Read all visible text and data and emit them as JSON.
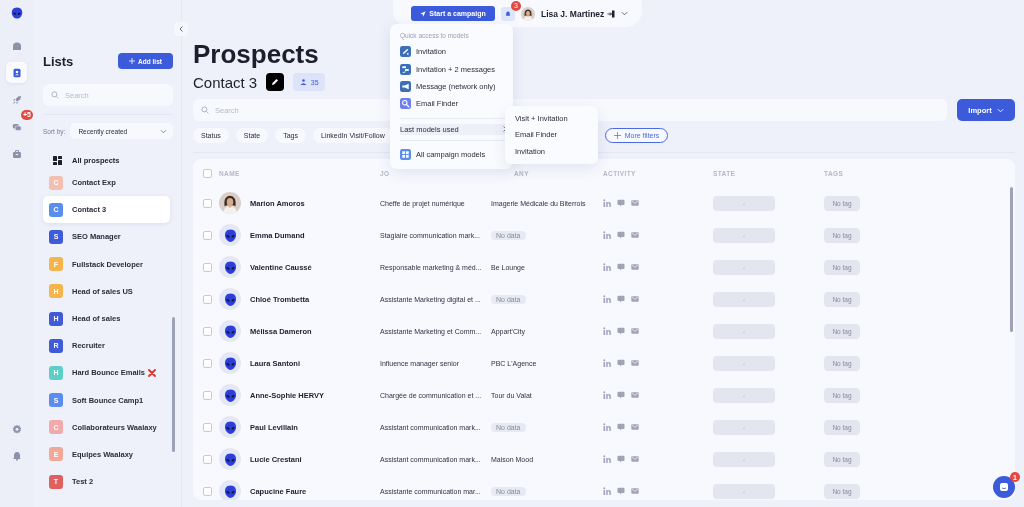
{
  "rail": {
    "items": [
      {
        "kind": "home",
        "selected": false
      },
      {
        "kind": "contacts",
        "selected": true
      },
      {
        "kind": "rocket",
        "selected": false
      },
      {
        "kind": "chat",
        "selected": false,
        "badge": "+5"
      },
      {
        "kind": "box",
        "selected": false
      }
    ],
    "bottom_items": [
      {
        "kind": "settings"
      },
      {
        "kind": "bell"
      }
    ]
  },
  "lists_panel": {
    "title": "Lists",
    "add_button": "Add list",
    "search": {
      "placeholder": "Search"
    },
    "sort_label": "Sort by:",
    "sort_value": "Recently created",
    "all_prospects": "All prospects",
    "items": [
      {
        "letter": "C",
        "name": "Contact Exp",
        "color": "#f4bfb0",
        "selected": false,
        "warning": false
      },
      {
        "letter": "C",
        "name": "Contact 3",
        "color": "#5b8def",
        "selected": true,
        "warning": false
      },
      {
        "letter": "S",
        "name": "SEO Manager",
        "color": "#3f5bd8",
        "selected": false,
        "warning": false
      },
      {
        "letter": "F",
        "name": "Fullstack Developer",
        "color": "#f5b54a",
        "selected": false,
        "warning": false
      },
      {
        "letter": "H",
        "name": "Head of sales US",
        "color": "#f5b54a",
        "selected": false,
        "warning": false
      },
      {
        "letter": "H",
        "name": "Head of sales",
        "color": "#3f5bd8",
        "selected": false,
        "warning": false
      },
      {
        "letter": "R",
        "name": "Recruiter",
        "color": "#3f5bd8",
        "selected": false,
        "warning": false
      },
      {
        "letter": "H",
        "name": "Hard Bounce Emails",
        "color": "#5ccfc9",
        "selected": false,
        "warning": true
      },
      {
        "letter": "S",
        "name": "Soft Bounce Camp1",
        "color": "#5b8def",
        "selected": false,
        "warning": false
      },
      {
        "letter": "C",
        "name": "Collaborateurs Waalaxy",
        "color": "#f2a9a9",
        "selected": false,
        "warning": false
      },
      {
        "letter": "E",
        "name": "Equipes Waalaxy",
        "color": "#f2a898",
        "selected": false,
        "warning": false
      },
      {
        "letter": "T",
        "name": "Test 2",
        "color": "#e06060",
        "selected": false,
        "warning": false
      }
    ]
  },
  "header": {
    "campaign_button": "Start a campaign",
    "notification_count": "3",
    "user_name": "Lisa J. Martinez"
  },
  "title": "Prospects",
  "list_name": "Contact 3",
  "member_count": "35",
  "search": {
    "placeholder": "Search"
  },
  "import_button": "Import",
  "filters": [
    "Status",
    "State",
    "Tags",
    "LinkedIn Visit/Follow"
  ],
  "more_filters": "More filters",
  "table": {
    "all_checked": false,
    "columns": [
      "NAME",
      "JO",
      "ANY",
      "ACTIVITY",
      "STATE",
      "TAGS"
    ],
    "rows": [
      {
        "checked": false,
        "name": "Marion Amoros",
        "job": "Cheffe de projet numérique",
        "company": {
          "kind": "text",
          "text": "Imagerie Médicale du Biterrois"
        },
        "state": "-",
        "tags": "No tag"
      },
      {
        "checked": false,
        "avatar": {
          "kind": "alien"
        },
        "name": "Emma Dumand",
        "job": "Stagiaire communication mark...",
        "company": {
          "kind": "empty",
          "text": "No data"
        },
        "state": "-",
        "tags": "No tag"
      },
      {
        "checked": false,
        "avatar": {
          "kind": "alien"
        },
        "name": "Valentine Caussé",
        "job": "Responsable marketing & méd...",
        "company": {
          "kind": "text",
          "text": "Be Lounge"
        },
        "state": "-",
        "tags": "No tag"
      },
      {
        "checked": false,
        "avatar": {
          "kind": "alien"
        },
        "name": "Chloé Trombetta",
        "job": "Assistante Marketing digital et ...",
        "company": {
          "kind": "empty",
          "text": "No data"
        },
        "state": "-",
        "tags": "No tag"
      },
      {
        "checked": false,
        "avatar": {
          "kind": "alien"
        },
        "name": "Mélissa Dameron",
        "job": "Assistante Marketing et Comm...",
        "company": {
          "kind": "text",
          "text": "Appart'City"
        },
        "state": "-",
        "tags": "No tag"
      },
      {
        "checked": false,
        "avatar": {
          "kind": "alien"
        },
        "name": "Laura Santoni",
        "job": "Influence manager senior",
        "company": {
          "kind": "text",
          "text": "PBC L'Agence"
        },
        "state": "-",
        "tags": "No tag"
      },
      {
        "checked": false,
        "avatar": {
          "kind": "alien"
        },
        "name": "Anne-Sophie HERVY",
        "job": "Chargée de communication et ...",
        "company": {
          "kind": "text",
          "text": "Tour du Valat"
        },
        "state": "-",
        "tags": "No tag"
      },
      {
        "checked": false,
        "avatar": {
          "kind": "alien"
        },
        "name": "Paul Levillain",
        "job": "Assistant communication mark...",
        "company": {
          "kind": "empty",
          "text": "No data"
        },
        "state": "-",
        "tags": "No tag"
      },
      {
        "checked": false,
        "avatar": {
          "kind": "alien"
        },
        "name": "Lucie Crestani",
        "job": "Assistant communication mark...",
        "company": {
          "kind": "text",
          "text": "Maison Mood"
        },
        "state": "-",
        "tags": "No tag"
      },
      {
        "checked": false,
        "avatar": {
          "kind": "alien"
        },
        "name": "Capucine Faure",
        "job": "Assistante communication mar...",
        "company": {
          "kind": "empty",
          "text": "No data"
        },
        "state": "-",
        "tags": "No tag"
      }
    ]
  },
  "campaign_menu": {
    "heading": "Quick access to models",
    "items": [
      {
        "kind": "link",
        "label": "Invitation"
      },
      {
        "kind": "sequence",
        "label": "Invitation + 2 messages"
      },
      {
        "kind": "megaphone",
        "label": "Message (network only)"
      },
      {
        "kind": "magnifier",
        "label": "Email Finder"
      }
    ],
    "submenu_trigger": {
      "label": "Last models used",
      "expanded": true
    },
    "submenu": [
      "Visit + Invitation",
      "Email Finder",
      "Invitation"
    ],
    "all_models": "All campaign models"
  },
  "chat_badge": "1"
}
